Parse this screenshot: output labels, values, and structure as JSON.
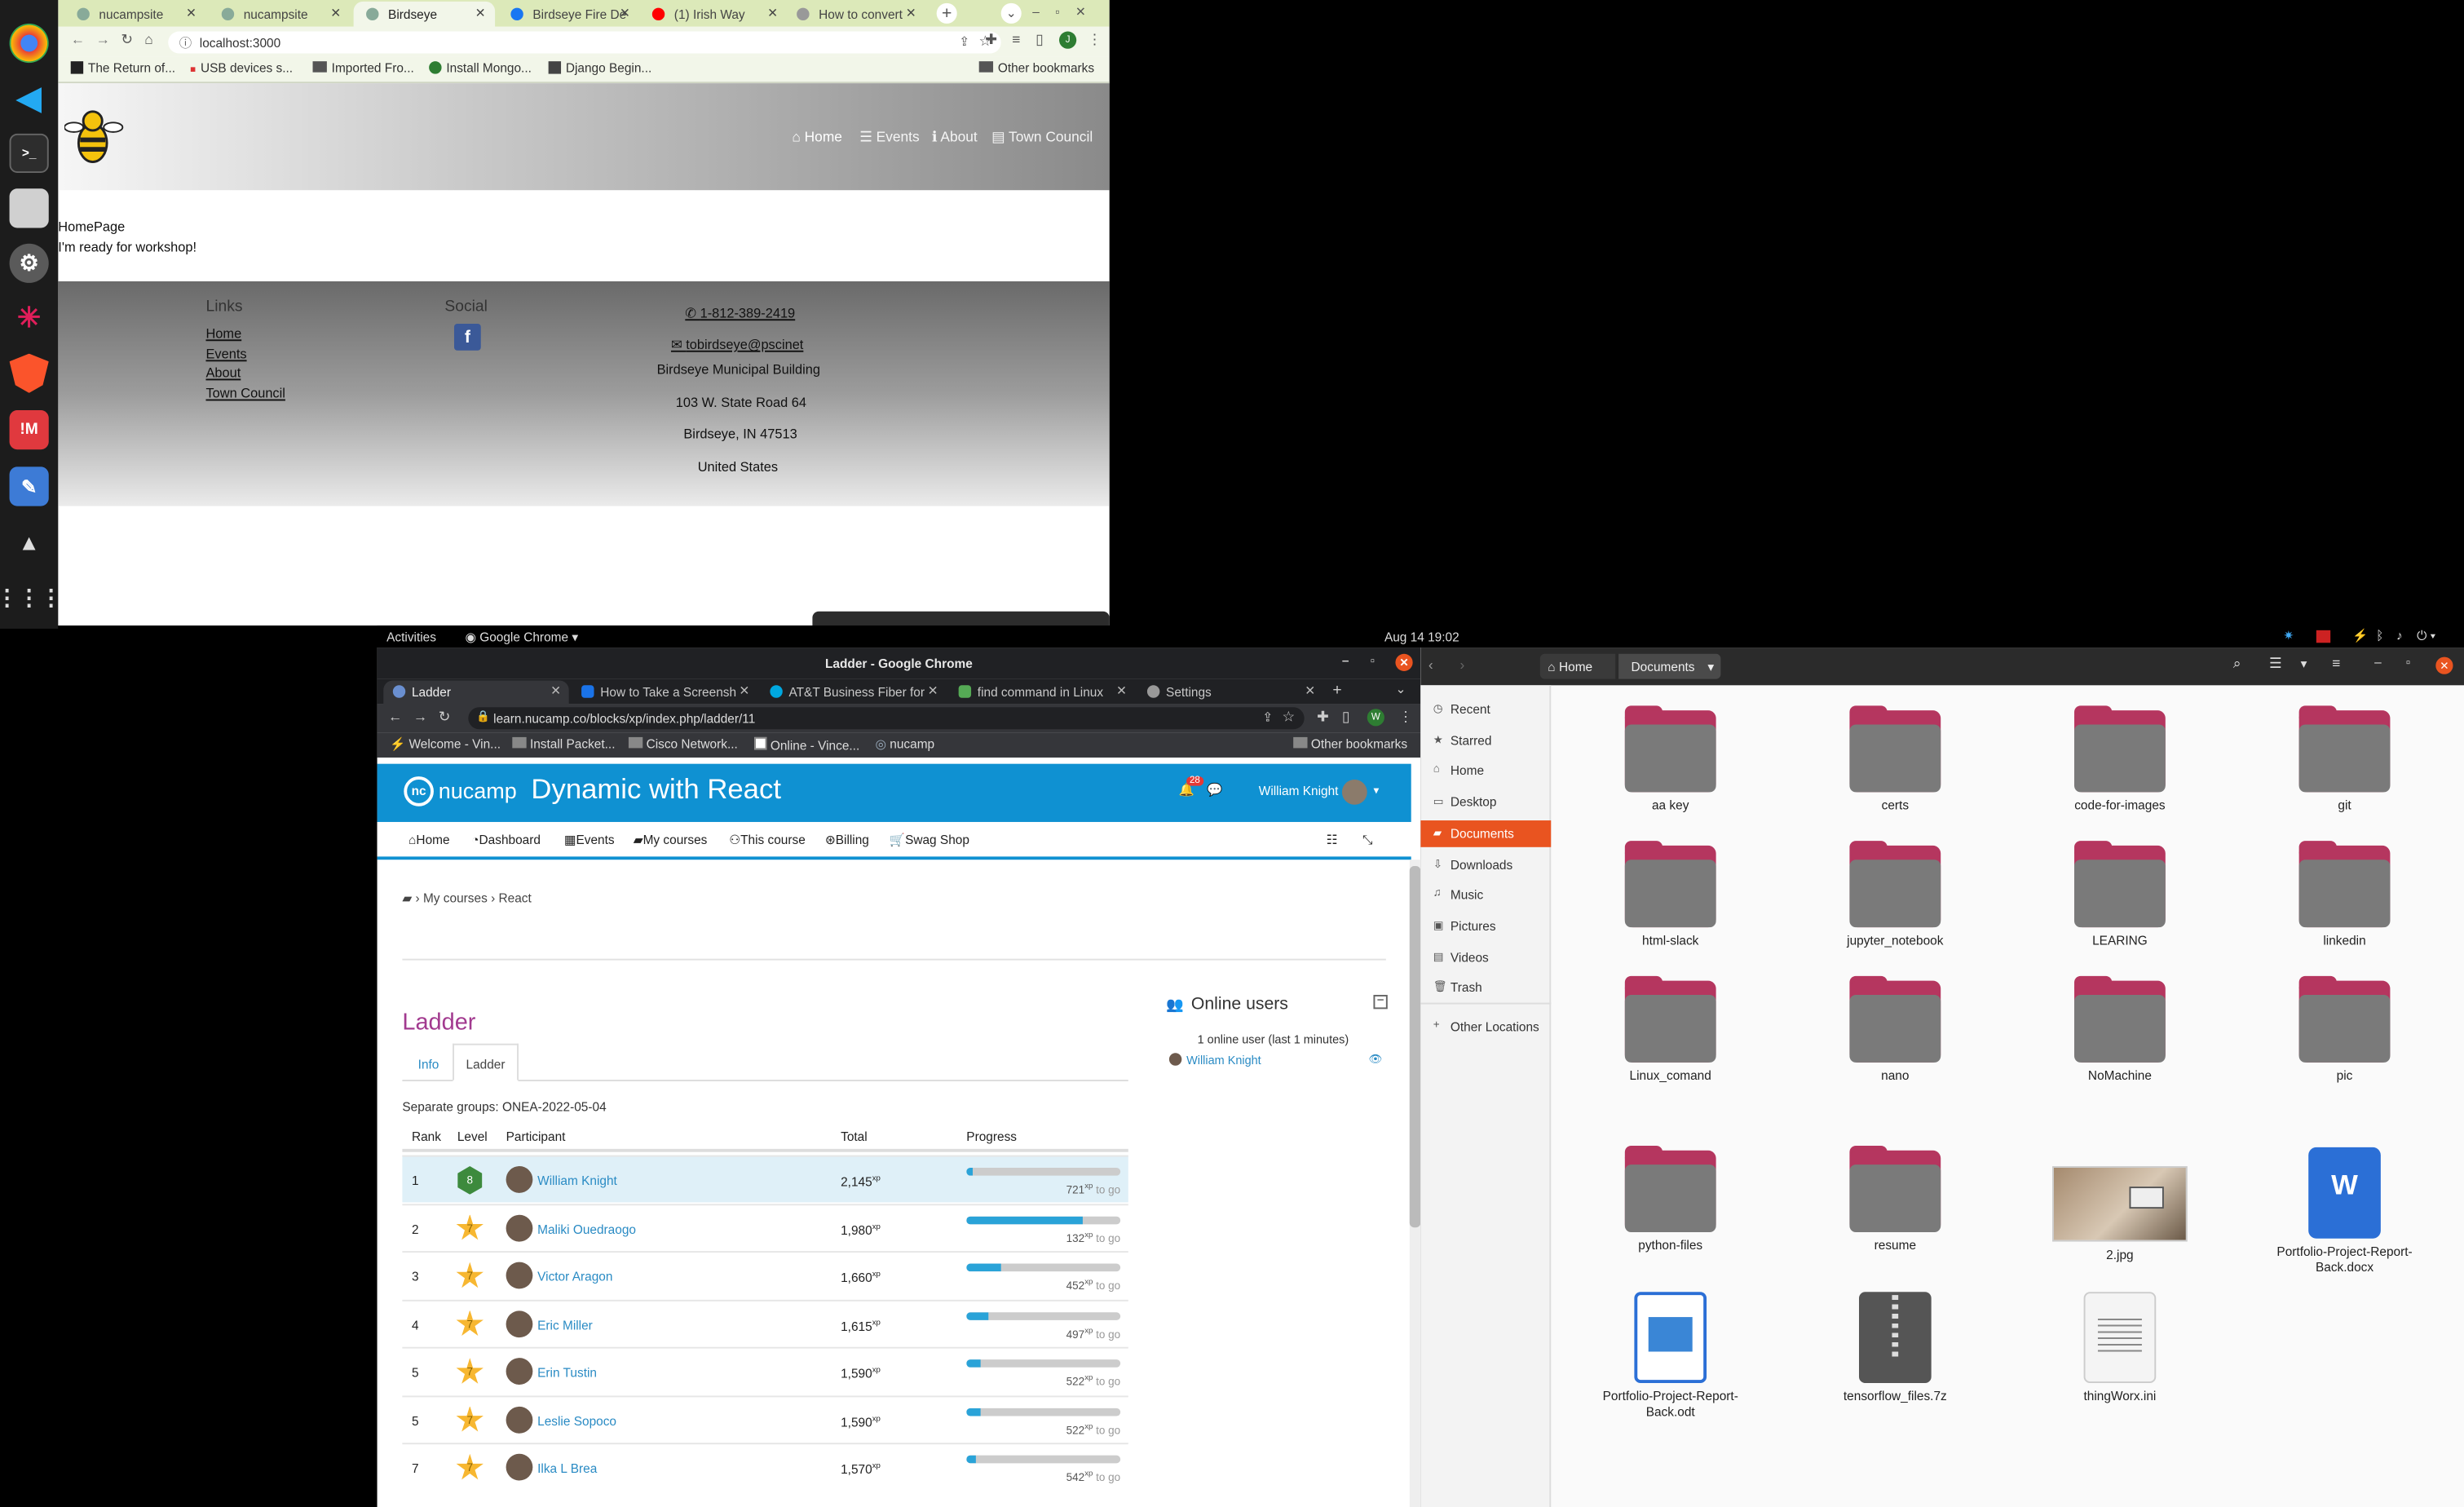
{
  "dock": {
    "items": [
      "Google Chrome",
      "Visual Studio Code",
      "Terminal",
      "Files",
      "Settings",
      "Slack",
      "Brave",
      "Meetup",
      "Text Editor",
      "VPN",
      "Show Applications"
    ]
  },
  "browser1": {
    "tabs": [
      {
        "label": "nucampsite"
      },
      {
        "label": "nucampsite"
      },
      {
        "label": "Birdseye"
      },
      {
        "label": "Birdseye Fire De"
      },
      {
        "label": "(1) Irish Way"
      },
      {
        "label": "How to convert"
      }
    ],
    "url": "localhost:3000",
    "bookmarks": [
      "The Return of...",
      "USB devices s...",
      "Imported Fro...",
      "Install Mongo...",
      "Django Begin..."
    ],
    "other_bookmarks": "Other bookmarks"
  },
  "birdseye": {
    "nav": {
      "home": "Home",
      "events": "Events",
      "about": "About",
      "council": "Town Council"
    },
    "body_title": "HomePage",
    "body_text": "I'm ready for workshop!",
    "footer": {
      "links_title": "Links",
      "links": [
        "Home",
        "Events",
        "About",
        "Town Council"
      ],
      "social_title": "Social",
      "phone": "1-812-389-2419",
      "email": "tobirdseye@pscinet",
      "address": [
        "Birdseye Municipal Building",
        "103 W. State Road 64",
        "Birdseye, IN 47513",
        "United States"
      ]
    }
  },
  "topbar": {
    "activities": "Activities",
    "app": "Google Chrome",
    "clock": "Aug 14  19:02"
  },
  "browser2": {
    "title": "Ladder - Google Chrome",
    "tabs": [
      {
        "label": "Ladder"
      },
      {
        "label": "How to Take a Screensh"
      },
      {
        "label": "AT&T Business Fiber for"
      },
      {
        "label": "find command in Linux"
      },
      {
        "label": "Settings"
      }
    ],
    "url": "learn.nucamp.co/blocks/xp/index.php/ladder/11",
    "bookmarks": [
      "Welcome - Vin...",
      "Install Packet...",
      "Cisco Network...",
      "Online - Vince...",
      "nucamp"
    ],
    "other_bookmarks": "Other bookmarks",
    "profile_letter": "W"
  },
  "nucamp": {
    "logo": "nucamp",
    "course_title": "Dynamic with React",
    "notif_count": "28",
    "user": "William Knight",
    "nav": [
      "Home",
      "Dashboard",
      "Events",
      "My courses",
      "This course",
      "Billing",
      "Swag Shop"
    ],
    "breadcrumb": [
      "My courses",
      "React"
    ],
    "ladder_title": "Ladder",
    "tabs": [
      "Info",
      "Ladder"
    ],
    "groups": "Separate groups: ONEA-2022-05-04",
    "columns": [
      "Rank",
      "Level",
      "Participant",
      "Total",
      "Progress"
    ],
    "rows": [
      {
        "rank": "1",
        "level": "8",
        "name": "William Knight",
        "total": "2,145",
        "xp": "xp",
        "togo": "721",
        "progress": 0.04
      },
      {
        "rank": "2",
        "level": "7",
        "name": "Maliki Ouedraogo",
        "total": "1,980",
        "xp": "xp",
        "togo": "132",
        "progress": 0.76
      },
      {
        "rank": "3",
        "level": "7",
        "name": "Victor Aragon",
        "total": "1,660",
        "xp": "xp",
        "togo": "452",
        "progress": 0.22
      },
      {
        "rank": "4",
        "level": "7",
        "name": "Eric Miller",
        "total": "1,615",
        "xp": "xp",
        "togo": "497",
        "progress": 0.14
      },
      {
        "rank": "5",
        "level": "7",
        "name": "Erin Tustin",
        "total": "1,590",
        "xp": "xp",
        "togo": "522",
        "progress": 0.09
      },
      {
        "rank": "5",
        "level": "7",
        "name": "Leslie Sopoco",
        "total": "1,590",
        "xp": "xp",
        "togo": "522",
        "progress": 0.09
      },
      {
        "rank": "7",
        "level": "7",
        "name": "Ilka L Brea",
        "total": "1,570",
        "xp": "xp",
        "togo": "542",
        "progress": 0.06
      }
    ],
    "togo_label": "to go",
    "online": {
      "title": "Online users",
      "summary": "1 online user (last 1 minutes)",
      "user": "William Knight"
    }
  },
  "files": {
    "path": [
      "Home",
      "Documents"
    ],
    "sidebar": [
      {
        "label": "Recent",
        "icon": "clock-icon"
      },
      {
        "label": "Starred",
        "icon": "star-icon"
      },
      {
        "label": "Home",
        "icon": "home-icon"
      },
      {
        "label": "Desktop",
        "icon": "desktop-icon"
      },
      {
        "label": "Documents",
        "icon": "folder-icon"
      },
      {
        "label": "Downloads",
        "icon": "download-icon"
      },
      {
        "label": "Music",
        "icon": "music-icon"
      },
      {
        "label": "Pictures",
        "icon": "picture-icon"
      },
      {
        "label": "Videos",
        "icon": "video-icon"
      },
      {
        "label": "Trash",
        "icon": "trash-icon"
      },
      {
        "label": "Other Locations",
        "icon": "plus-icon"
      }
    ],
    "items": [
      "aa key",
      "certs",
      "code-for-images",
      "git",
      "html-slack",
      "jupyter_notebook",
      "LEARING",
      "linkedin",
      "Linux_comand",
      "nano",
      "NoMachine",
      "pic",
      "python-files",
      "resume",
      "2.jpg",
      "Portfolio-Project-Report-Back.docx",
      "Portfolio-Project-Report-Back.odt",
      "tensorflow_files.7z",
      "thingWorx.ini"
    ]
  }
}
